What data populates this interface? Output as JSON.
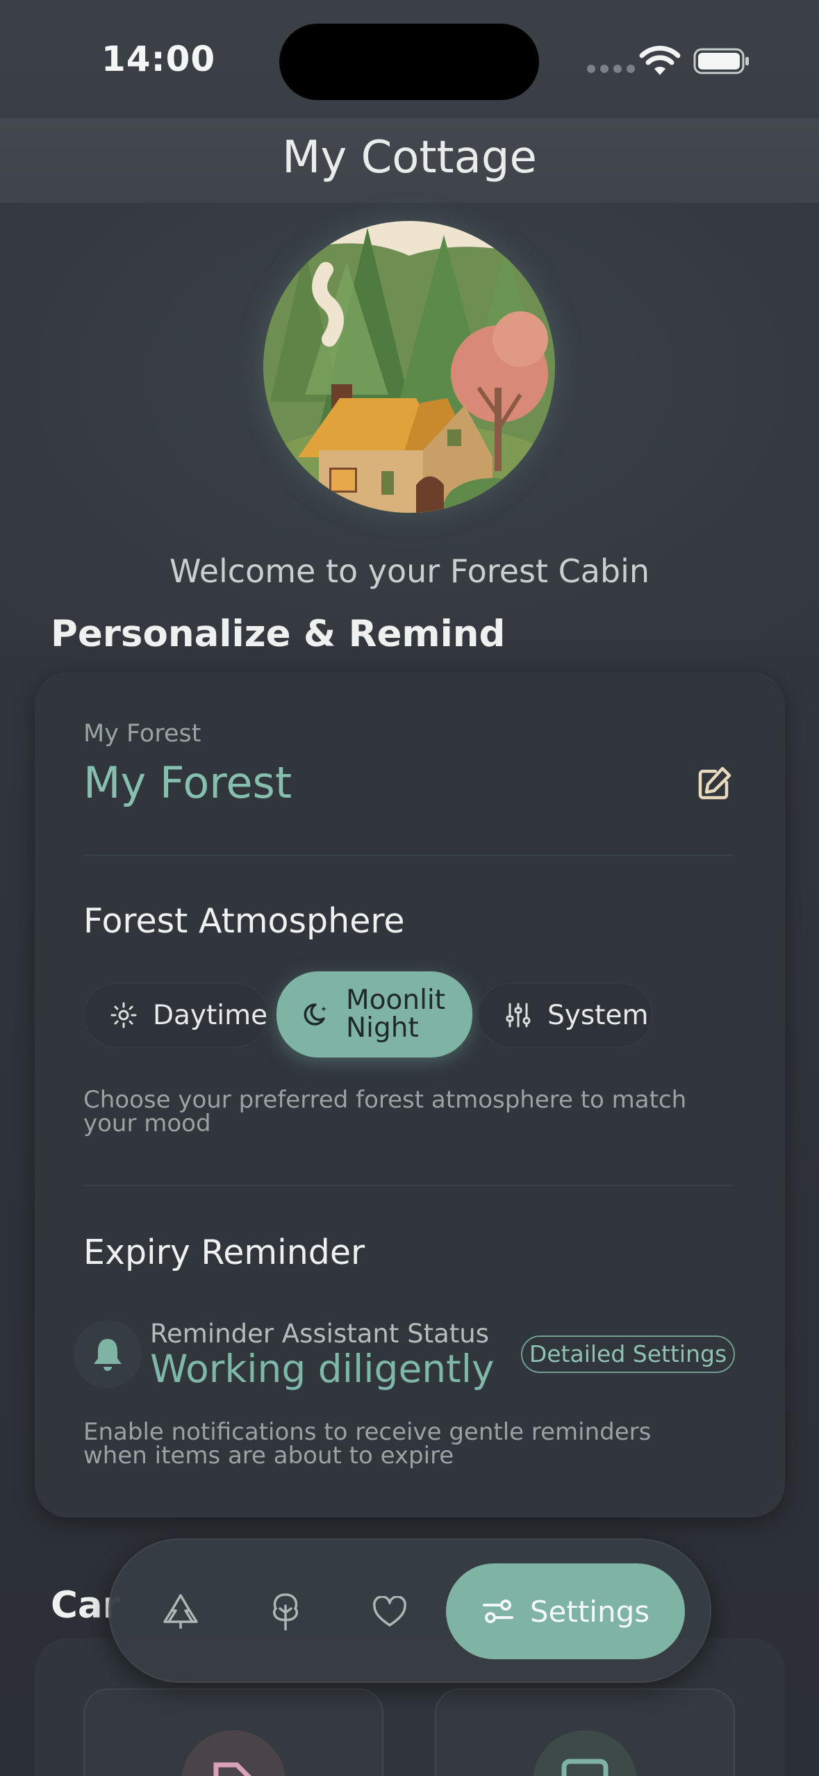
{
  "status_bar": {
    "time": "14:00"
  },
  "header": {
    "title": "My Cottage"
  },
  "hero": {
    "welcome": "Welcome to your Forest Cabin"
  },
  "sections": {
    "personalize": "Personalize & Remind",
    "care": "Car"
  },
  "forest": {
    "caption": "My Forest",
    "name": "My Forest"
  },
  "atmosphere": {
    "title": "Forest Atmosphere",
    "options": [
      {
        "label": "Daytime",
        "icon": "sun-icon",
        "selected": false
      },
      {
        "label": "Moonlit Night",
        "icon": "moon-icon",
        "selected": true
      },
      {
        "label": "System",
        "icon": "sliders-icon",
        "selected": false
      }
    ],
    "help": "Choose your preferred forest atmosphere to match your mood"
  },
  "reminder": {
    "title": "Expiry Reminder",
    "status_label": "Reminder Assistant Status",
    "status_value": "Working diligently",
    "detail_button": "Detailed Settings",
    "help": "Enable notifications to receive gentle reminders when items are about to expire"
  },
  "tab_bar": {
    "items": [
      {
        "icon": "trees-icon"
      },
      {
        "icon": "tree-icon"
      },
      {
        "icon": "heart-icon"
      },
      {
        "icon": "settings-icon",
        "label": "Settings",
        "active": true
      }
    ]
  },
  "colors": {
    "accent": "#7fb3a3",
    "accent_text": "#86bfae",
    "background": "#2f343a",
    "card": "#30363c"
  }
}
